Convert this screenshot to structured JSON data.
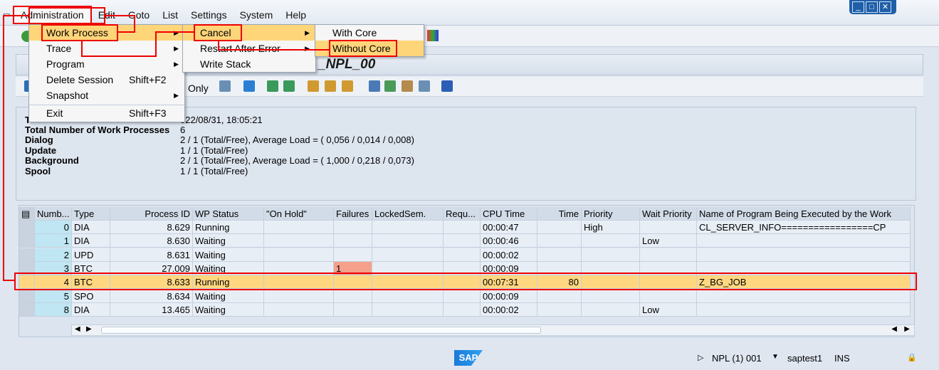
{
  "menubar": [
    "Administration",
    "Edit",
    "Goto",
    "List",
    "Settings",
    "System",
    "Help"
  ],
  "title": "_NPL_00",
  "toolbar2": {
    "only_label": "Only"
  },
  "info": [
    {
      "label": "T",
      "value": "022/08/31, 18:05:21"
    },
    {
      "label": "Total Number of Work Processes",
      "value": "6"
    },
    {
      "label": "Dialog",
      "value": "2 / 1 (Total/Free), Average Load = ( 0,056 / 0,014 / 0,008)"
    },
    {
      "label": "Update",
      "value": "1 / 1 (Total/Free)"
    },
    {
      "label": "Background",
      "value": "2 / 1 (Total/Free), Average Load = ( 1,000 / 0,218 / 0,073)"
    },
    {
      "label": "Spool",
      "value": "1 / 1 (Total/Free)"
    }
  ],
  "table": {
    "headers": [
      "Numb...",
      "Type",
      "Process ID",
      "WP Status",
      "\"On Hold\"",
      "Failures",
      "LockedSem.",
      "Requ...",
      "CPU Time",
      "Time",
      "Priority",
      "Wait Priority",
      "Name of Program Being Executed by the Work"
    ],
    "rows": [
      [
        "0",
        "DIA",
        "8.629",
        "Running",
        "",
        "",
        "",
        "",
        "00:00:47",
        "",
        "High",
        "",
        "CL_SERVER_INFO=================CP"
      ],
      [
        "1",
        "DIA",
        "8.630",
        "Waiting",
        "",
        "",
        "",
        "",
        "00:00:46",
        "",
        "",
        "Low",
        ""
      ],
      [
        "2",
        "UPD",
        "8.631",
        "Waiting",
        "",
        "",
        "",
        "",
        "00:00:02",
        "",
        "",
        "",
        ""
      ],
      [
        "3",
        "BTC",
        "27.009",
        "Waiting",
        "",
        "1",
        "",
        "",
        "00:00:09",
        "",
        "",
        "",
        ""
      ],
      [
        "4",
        "BTC",
        "8.633",
        "Running",
        "",
        "",
        "",
        "",
        "00:07:31",
        "80",
        "",
        "",
        "Z_BG_JOB"
      ],
      [
        "5",
        "SPO",
        "8.634",
        "Waiting",
        "",
        "",
        "",
        "",
        "00:00:09",
        "",
        "",
        "",
        ""
      ],
      [
        "8",
        "DIA",
        "13.465",
        "Waiting",
        "",
        "",
        "",
        "",
        "00:00:02",
        "",
        "",
        "Low",
        ""
      ]
    ]
  },
  "menu_admin": [
    {
      "label": "Work Process",
      "shortcut": "",
      "submenu": true
    },
    {
      "label": "Trace",
      "shortcut": "",
      "submenu": true
    },
    {
      "label": "Program",
      "shortcut": "",
      "submenu": true
    },
    {
      "label": "Delete Session",
      "shortcut": "Shift+F2",
      "submenu": false
    },
    {
      "label": "Snapshot",
      "shortcut": "",
      "submenu": true
    },
    {
      "label": "Exit",
      "shortcut": "Shift+F3",
      "submenu": false
    }
  ],
  "menu_wp": [
    {
      "label": "Cancel",
      "submenu": true
    },
    {
      "label": "Restart After Error",
      "submenu": true
    },
    {
      "label": "Write Stack",
      "submenu": false
    }
  ],
  "menu_cancel": [
    {
      "label": "With Core"
    },
    {
      "label": "Without Core"
    }
  ],
  "status": {
    "system": "NPL (1) 001",
    "host": "saptest1",
    "mode": "INS",
    "logo": "SAP"
  }
}
